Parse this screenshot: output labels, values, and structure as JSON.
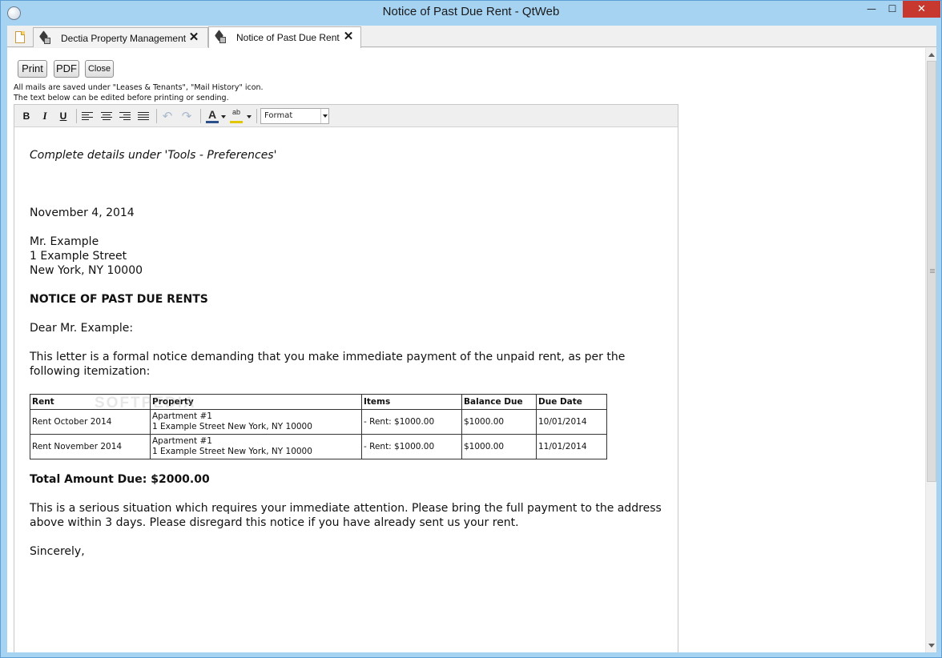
{
  "window": {
    "title": "Notice of Past Due Rent - QtWeb",
    "min_glyph": "—",
    "max_glyph": "☐",
    "close_glyph": "✕"
  },
  "tabs": [
    {
      "label": "Dectia Property Management",
      "active": false
    },
    {
      "label": "Notice of Past Due Rent",
      "active": true
    }
  ],
  "tab_close_glyph": "✕",
  "controls": {
    "print": "Print",
    "pdf": "PDF",
    "close": "Close"
  },
  "info": {
    "line1": "All mails are saved under \"Leases & Tenants\", \"Mail History\" icon.",
    "line2": "The text below can be edited before printing or sending."
  },
  "toolbar": {
    "bold": "B",
    "italic": "I",
    "underline": "U",
    "font_color_glyph": "A",
    "highlight_glyph": "ab",
    "undo_glyph": "↶",
    "redo_glyph": "↷",
    "format_value": "Format"
  },
  "letter": {
    "italic_note": "Complete details under 'Tools - Preferences'",
    "date": "November 4, 2014",
    "recipient_name": "Mr. Example",
    "recipient_street": "1 Example Street",
    "recipient_city": "New York, NY 10000",
    "heading": "NOTICE OF PAST DUE RENTS",
    "salutation": "Dear Mr. Example:",
    "intro_line1": "This letter is a formal notice demanding that you make immediate payment of the unpaid rent, as per the",
    "intro_line2": "following itemization:",
    "table": {
      "headers": [
        "Rent",
        "Property",
        "Items",
        "Balance Due",
        "Due Date"
      ],
      "rows": [
        {
          "rent": "Rent October 2014",
          "property_line1": "Apartment #1",
          "property_line2": "1 Example Street New York, NY 10000",
          "items": "- Rent: $1000.00",
          "balance": "$1000.00",
          "due": "10/01/2014"
        },
        {
          "rent": "Rent November 2014",
          "property_line1": "Apartment #1",
          "property_line2": "1 Example Street New York, NY 10000",
          "items": "- Rent: $1000.00",
          "balance": "$1000.00",
          "due": "11/01/2014"
        }
      ]
    },
    "total": "Total Amount Due: $2000.00",
    "serious_line1": "This is a serious situation which requires your immediate attention. Please bring the full payment to the address",
    "serious_line2": "above within 3 days. Please disregard this notice if you have already sent us your rent.",
    "closing": "Sincerely,"
  },
  "watermark": "SOFTPEDIA"
}
